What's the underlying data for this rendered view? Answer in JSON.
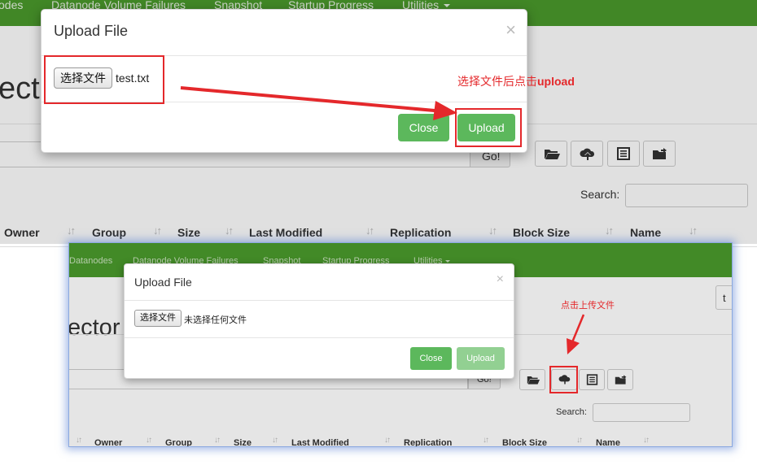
{
  "top": {
    "nav": [
      "odes",
      "Datanode Volume Failures",
      "Snapshot",
      "Startup Progress",
      "Utilities"
    ],
    "page_title": "ector",
    "go_label": "Go!",
    "search_label": "Search:",
    "columns": [
      "Owner",
      "Group",
      "Size",
      "Last Modified",
      "Replication",
      "Block Size",
      "Name"
    ],
    "sort_glyph": "↓↑",
    "modal": {
      "title": "Upload File",
      "close_glyph": "×",
      "choose_file": "选择文件",
      "file_name": "test.txt",
      "close_button": "Close",
      "upload_button": "Upload"
    },
    "annotation": {
      "text": "选择文件后点击",
      "bold": "upload"
    }
  },
  "inset": {
    "nav": [
      "Datanodes",
      "Datanode Volume Failures",
      "Snapshot",
      "Startup Progress",
      "Utilities"
    ],
    "page_title": "ector",
    "go_label": "Go!",
    "search_label": "Search:",
    "columns": [
      "Owner",
      "Group",
      "Size",
      "Last Modified",
      "Replication",
      "Block Size",
      "Name"
    ],
    "sort_glyph": "↓↑",
    "side_glyph": "t",
    "modal": {
      "title": "Upload File",
      "close_glyph": "×",
      "choose_file": "选择文件",
      "file_name": "未选择任何文件",
      "close_button": "Close",
      "upload_button": "Upload"
    },
    "annotation": "点击上传文件"
  },
  "icons": [
    "folder-open-icon",
    "cloud-upload-icon",
    "list-icon",
    "folder-share-icon"
  ],
  "colors": {
    "navbar": "#4a9a2c",
    "success": "#5cb85c",
    "success_disabled": "#92d092",
    "annotation_red": "#e4282b"
  }
}
